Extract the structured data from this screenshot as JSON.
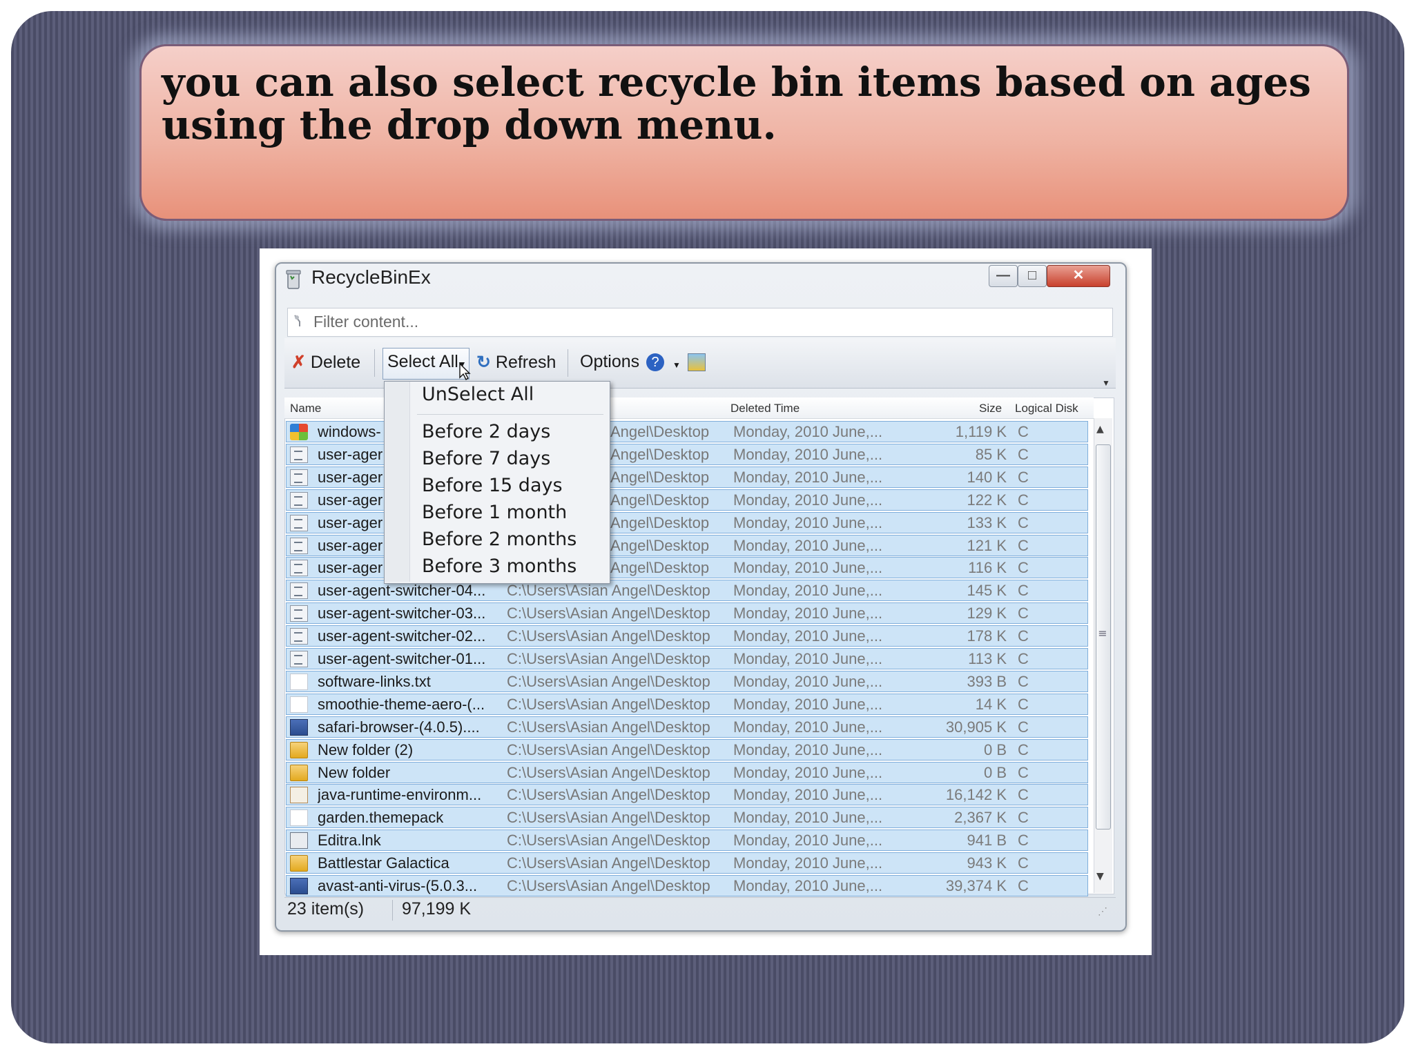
{
  "caption": "you can also select recycle bin items based on ages\nusing  the drop down menu.",
  "window": {
    "title": "RecycleBinEx",
    "controls": [
      "minimize",
      "maximize",
      "close"
    ]
  },
  "filter": {
    "placeholder": "Filter content..."
  },
  "toolbar": {
    "delete_label": "Delete",
    "select_all_label": "Select All",
    "refresh_label": "Refresh",
    "options_label": "Options"
  },
  "columns": {
    "name": "Name",
    "deleted_time": "Deleted Time",
    "size": "Size",
    "logical_disk": "Logical Disk"
  },
  "rows": [
    {
      "icon": "windows-icon",
      "name": "windows-",
      "path": "Angel\\Desktop",
      "time": "Monday, 2010 June,...",
      "size": "1,119 K",
      "disk": "C"
    },
    {
      "icon": "document-icon",
      "name": "user-ager",
      "path": "Angel\\Desktop",
      "time": "Monday, 2010 June,...",
      "size": "85 K",
      "disk": "C"
    },
    {
      "icon": "document-icon",
      "name": "user-ager",
      "path": "Angel\\Desktop",
      "time": "Monday, 2010 June,...",
      "size": "140 K",
      "disk": "C"
    },
    {
      "icon": "document-icon",
      "name": "user-ager",
      "path": "Angel\\Desktop",
      "time": "Monday, 2010 June,...",
      "size": "122 K",
      "disk": "C"
    },
    {
      "icon": "document-icon",
      "name": "user-ager",
      "path": "Angel\\Desktop",
      "time": "Monday, 2010 June,...",
      "size": "133 K",
      "disk": "C"
    },
    {
      "icon": "document-icon",
      "name": "user-ager",
      "path": "Angel\\Desktop",
      "time": "Monday, 2010 June,...",
      "size": "121 K",
      "disk": "C"
    },
    {
      "icon": "document-icon",
      "name": "user-ager",
      "path": "Angel\\Desktop",
      "time": "Monday, 2010 June,...",
      "size": "116 K",
      "disk": "C"
    },
    {
      "icon": "document-icon",
      "name": "user-agent-switcher-04...",
      "path": "C:\\Users\\Asian Angel\\Desktop",
      "time": "Monday, 2010 June,...",
      "size": "145 K",
      "disk": "C"
    },
    {
      "icon": "document-icon",
      "name": "user-agent-switcher-03...",
      "path": "C:\\Users\\Asian Angel\\Desktop",
      "time": "Monday, 2010 June,...",
      "size": "129 K",
      "disk": "C"
    },
    {
      "icon": "document-icon",
      "name": "user-agent-switcher-02...",
      "path": "C:\\Users\\Asian Angel\\Desktop",
      "time": "Monday, 2010 June,...",
      "size": "178 K",
      "disk": "C"
    },
    {
      "icon": "document-icon",
      "name": "user-agent-switcher-01...",
      "path": "C:\\Users\\Asian Angel\\Desktop",
      "time": "Monday, 2010 June,...",
      "size": "113 K",
      "disk": "C"
    },
    {
      "icon": "text-file-icon",
      "name": "software-links.txt",
      "path": "C:\\Users\\Asian Angel\\Desktop",
      "time": "Monday, 2010 June,...",
      "size": "393 B",
      "disk": "C"
    },
    {
      "icon": "text-file-icon",
      "name": "smoothie-theme-aero-(...",
      "path": "C:\\Users\\Asian Angel\\Desktop",
      "time": "Monday, 2010 June,...",
      "size": "14 K",
      "disk": "C"
    },
    {
      "icon": "installer-icon",
      "name": "safari-browser-(4.0.5)....",
      "path": "C:\\Users\\Asian Angel\\Desktop",
      "time": "Monday, 2010 June,...",
      "size": "30,905 K",
      "disk": "C"
    },
    {
      "icon": "folder-icon",
      "name": "New folder (2)",
      "path": "C:\\Users\\Asian Angel\\Desktop",
      "time": "Monday, 2010 June,...",
      "size": "0 B",
      "disk": "C"
    },
    {
      "icon": "folder-icon",
      "name": "New folder",
      "path": "C:\\Users\\Asian Angel\\Desktop",
      "time": "Monday, 2010 June,...",
      "size": "0 B",
      "disk": "C"
    },
    {
      "icon": "java-icon",
      "name": "java-runtime-environm...",
      "path": "C:\\Users\\Asian Angel\\Desktop",
      "time": "Monday, 2010 June,...",
      "size": "16,142 K",
      "disk": "C"
    },
    {
      "icon": "themepack-icon",
      "name": "garden.themepack",
      "path": "C:\\Users\\Asian Angel\\Desktop",
      "time": "Monday, 2010 June,...",
      "size": "2,367 K",
      "disk": "C"
    },
    {
      "icon": "shortcut-icon",
      "name": "Editra.lnk",
      "path": "C:\\Users\\Asian Angel\\Desktop",
      "time": "Monday, 2010 June,...",
      "size": "941 B",
      "disk": "C"
    },
    {
      "icon": "folder-icon",
      "name": "Battlestar Galactica",
      "path": "C:\\Users\\Asian Angel\\Desktop",
      "time": "Monday, 2010 June,...",
      "size": "943 K",
      "disk": "C"
    },
    {
      "icon": "application-icon",
      "name": "avast-anti-virus-(5.0.3...",
      "path": "C:\\Users\\Asian Angel\\Desktop",
      "time": "Monday, 2010 June,...",
      "size": "39,374 K",
      "disk": "C"
    }
  ],
  "status": {
    "count": "23 item(s)",
    "total": "97,199 K"
  },
  "menu": {
    "items": [
      "UnSelect All",
      "Before 2 days",
      "Before 7 days",
      "Before 15 days",
      "Before 1 month",
      "Before 2 months",
      "Before 3 months"
    ]
  },
  "colors": {
    "selection": "#cde4f7",
    "selection_border": "#80aedb",
    "close_button": "#c8402c"
  }
}
